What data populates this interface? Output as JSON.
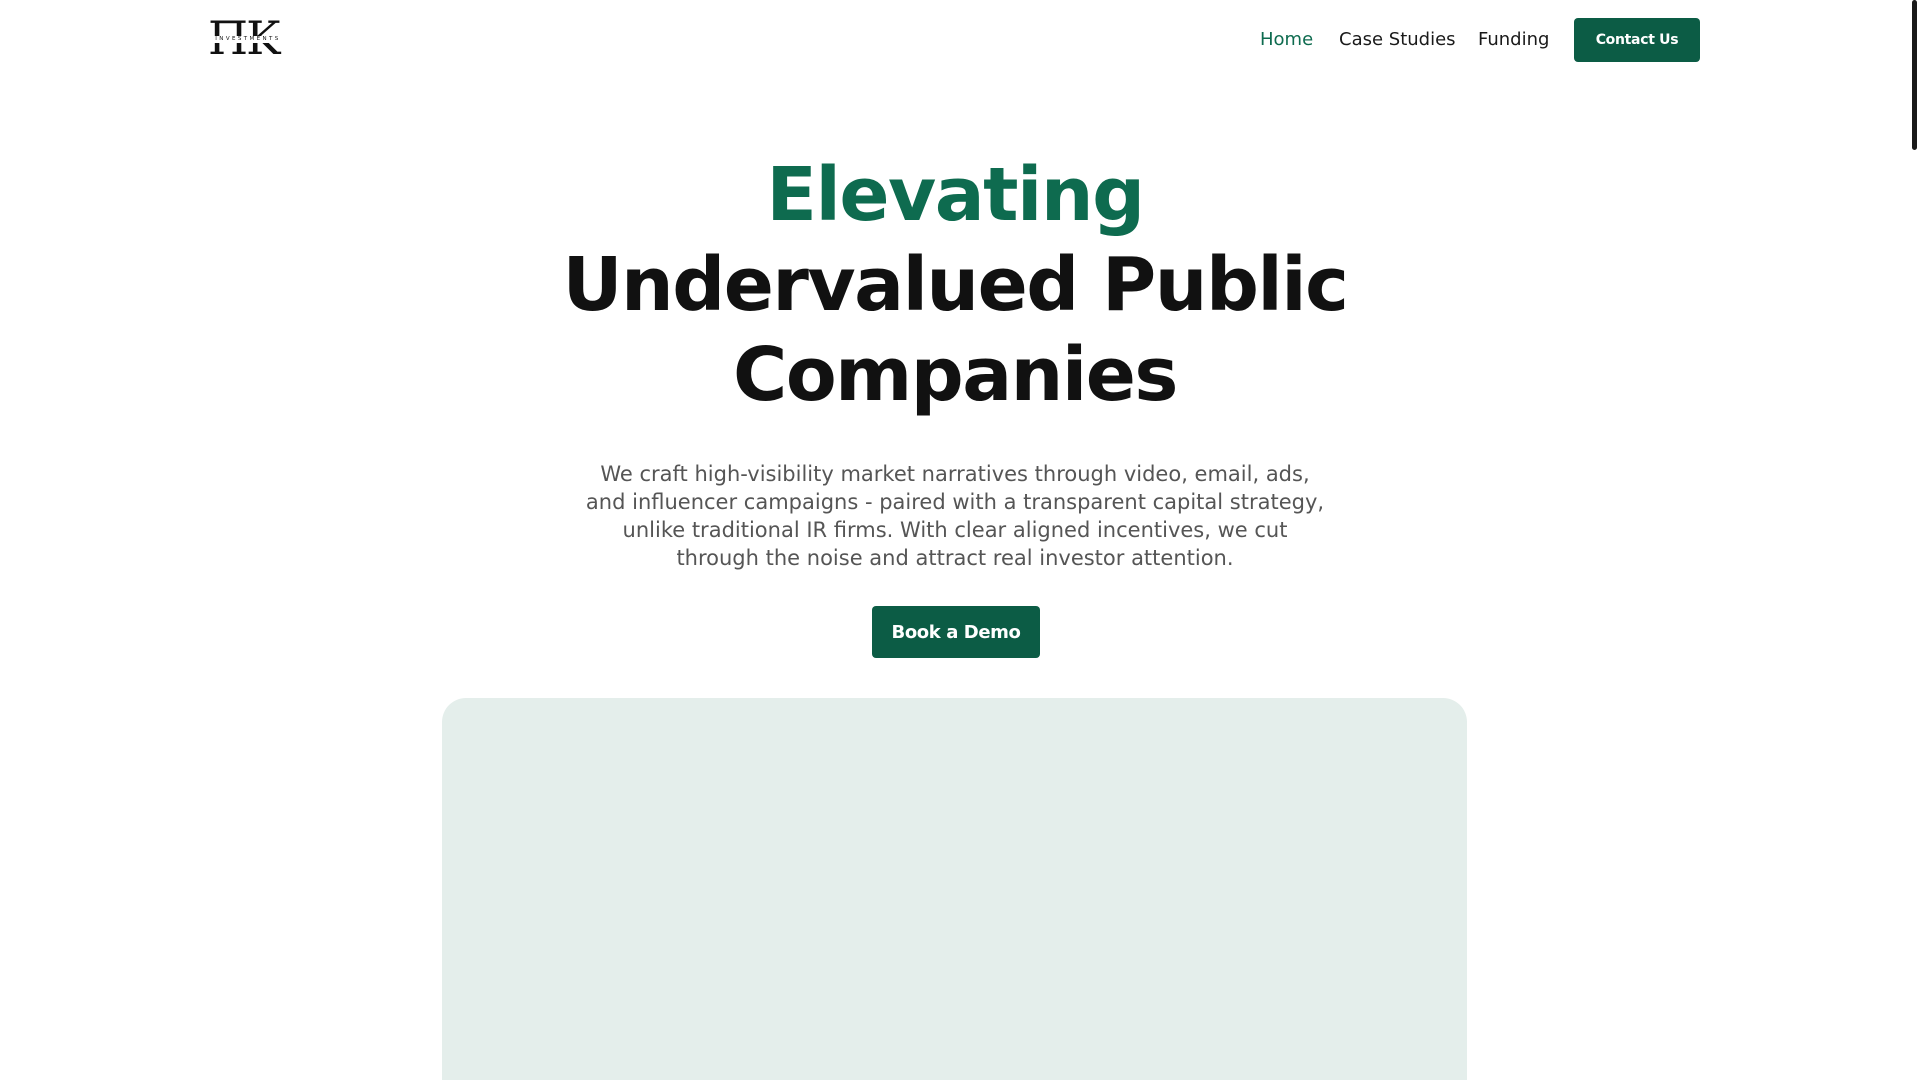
{
  "header": {
    "logo": {
      "letters": "ΠK",
      "subtitle": "INVESTMENTS"
    },
    "nav": [
      {
        "label": "Home",
        "active": true
      },
      {
        "label": "Case Studies",
        "active": false
      },
      {
        "label": "Funding",
        "active": false
      }
    ],
    "contact_label": "Contact Us"
  },
  "hero": {
    "title_accent": "Elevating",
    "title_line_1": "Undervalued Public",
    "title_line_2": "Companies",
    "subtitle": "We craft high-visibility market narratives through video, email, ads, and influencer campaigns - paired with a transparent capital strategy, unlike traditional IR firms. With clear aligned incentives, we cut through the noise and attract real investor attention.",
    "cta_label": "Book a Demo"
  },
  "colors": {
    "accent": "#0e6b4f",
    "button": "#0c5c45",
    "panel": "#e4eeeb",
    "text": "#111111",
    "muted": "#555555"
  }
}
